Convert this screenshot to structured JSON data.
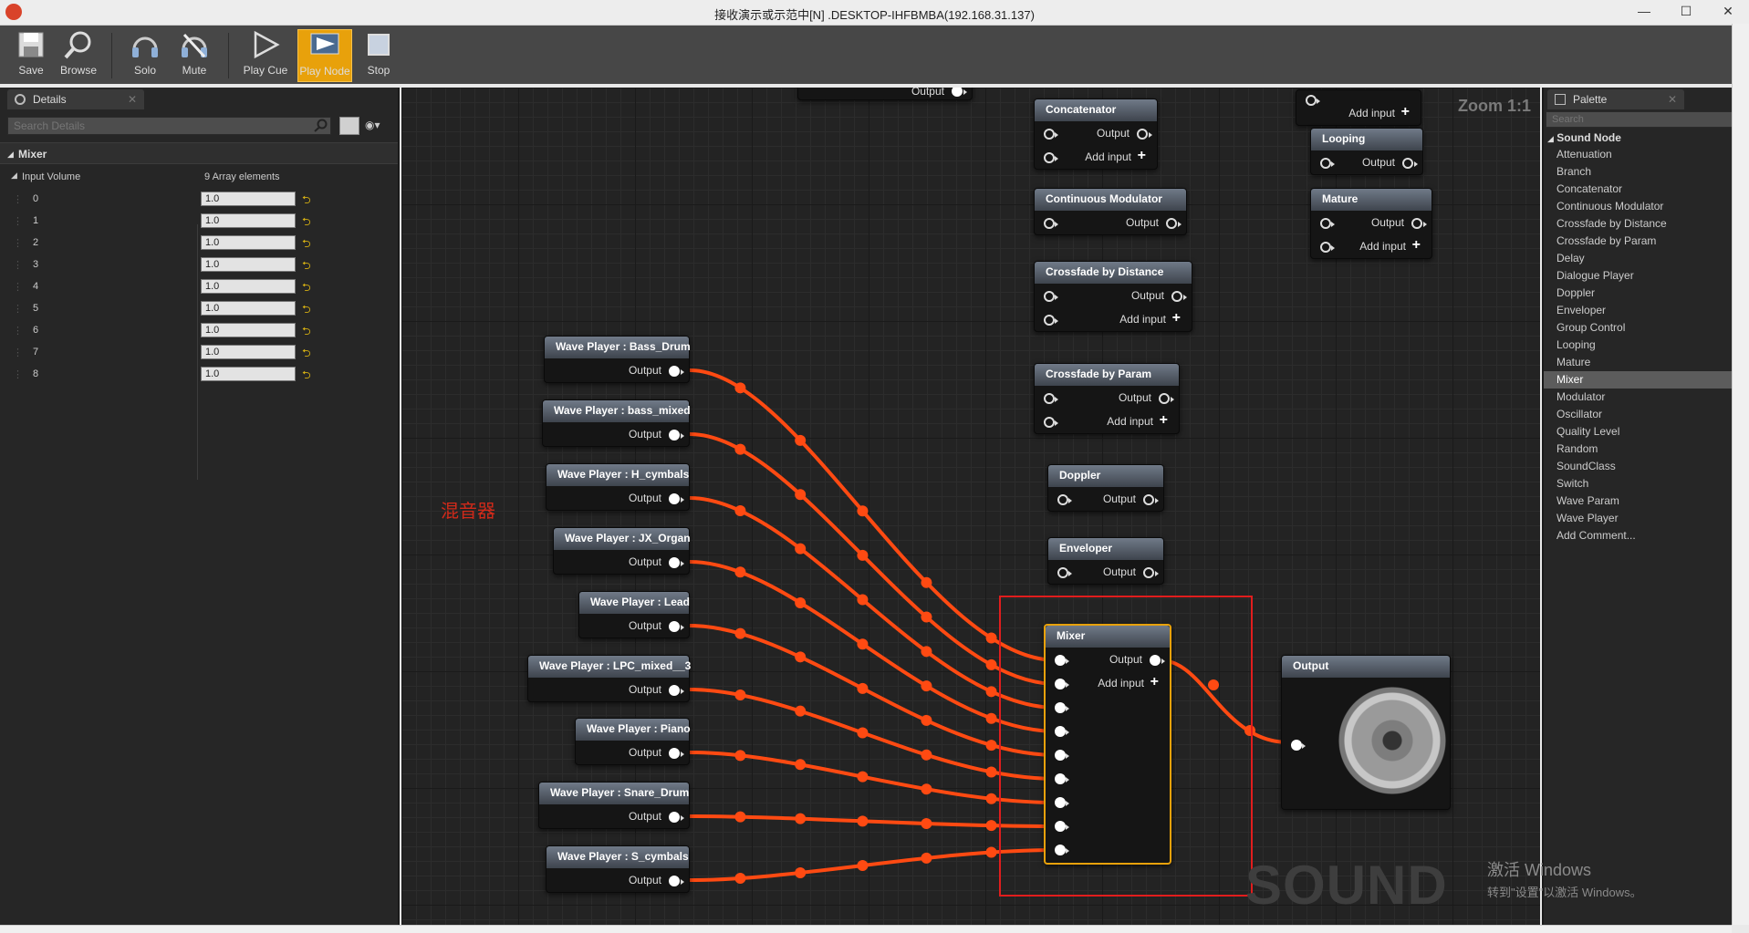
{
  "window": {
    "title": "接收演示或示范中[N] .DESKTOP-IHFBMBA(192.168.31.137)",
    "min": "—",
    "max": "☐",
    "close": "✕"
  },
  "toolbar": {
    "save": "Save",
    "browse": "Browse",
    "solo": "Solo",
    "mute": "Mute",
    "play_cue": "Play Cue",
    "play_node": "Play Node",
    "stop": "Stop"
  },
  "details": {
    "tab": "Details",
    "search_placeholder": "Search Details",
    "section": "Mixer",
    "input_volume_label": "Input Volume",
    "array_label": "9 Array elements",
    "rows": [
      {
        "index": "0",
        "value": "1.0"
      },
      {
        "index": "1",
        "value": "1.0"
      },
      {
        "index": "2",
        "value": "1.0"
      },
      {
        "index": "3",
        "value": "1.0"
      },
      {
        "index": "4",
        "value": "1.0"
      },
      {
        "index": "5",
        "value": "1.0"
      },
      {
        "index": "6",
        "value": "1.0"
      },
      {
        "index": "7",
        "value": "1.0"
      },
      {
        "index": "8",
        "value": "1.0"
      }
    ]
  },
  "graph": {
    "zoom": "Zoom 1:1",
    "watermark": "SOUND CUE",
    "annotation": "混音器",
    "output_label": "Output",
    "add_input_label": "Add input",
    "wave_players": [
      "Wave Player : Bass_Drum",
      "Wave Player : bass_mixed",
      "Wave Player : H_cymbals",
      "Wave Player : JX_Organ",
      "Wave Player : Lead",
      "Wave Player : LPC_mixed__3",
      "Wave Player : Piano",
      "Wave Player : Snare_Drum",
      "Wave Player : S_cymbals"
    ],
    "nodes": {
      "concatenator": "Concatenator",
      "continuous_modulator": "Continuous Modulator",
      "crossfade_distance": "Crossfade by Distance",
      "crossfade_param": "Crossfade by Param",
      "doppler": "Doppler",
      "enveloper": "Enveloper",
      "mixer": "Mixer",
      "looping": "Looping",
      "mature": "Mature",
      "output": "Output"
    }
  },
  "palette": {
    "tab": "Palette",
    "search_placeholder": "Search",
    "category": "Sound Node",
    "items": [
      "Attenuation",
      "Branch",
      "Concatenator",
      "Continuous Modulator",
      "Crossfade by Distance",
      "Crossfade by Param",
      "Delay",
      "Dialogue Player",
      "Doppler",
      "Enveloper",
      "Group Control",
      "Looping",
      "Mature",
      "Mixer",
      "Modulator",
      "Oscillator",
      "Quality Level",
      "Random",
      "SoundClass",
      "Switch",
      "Wave Param",
      "Wave Player",
      "Add Comment..."
    ],
    "selected": "Mixer"
  },
  "os": {
    "activate_title": "激活 Windows",
    "activate_sub": "转到\"设置\"以激活 Windows。"
  },
  "colors": {
    "wire": "#ff4a12",
    "accent": "#e8a10b",
    "box": "#e11d1d"
  }
}
